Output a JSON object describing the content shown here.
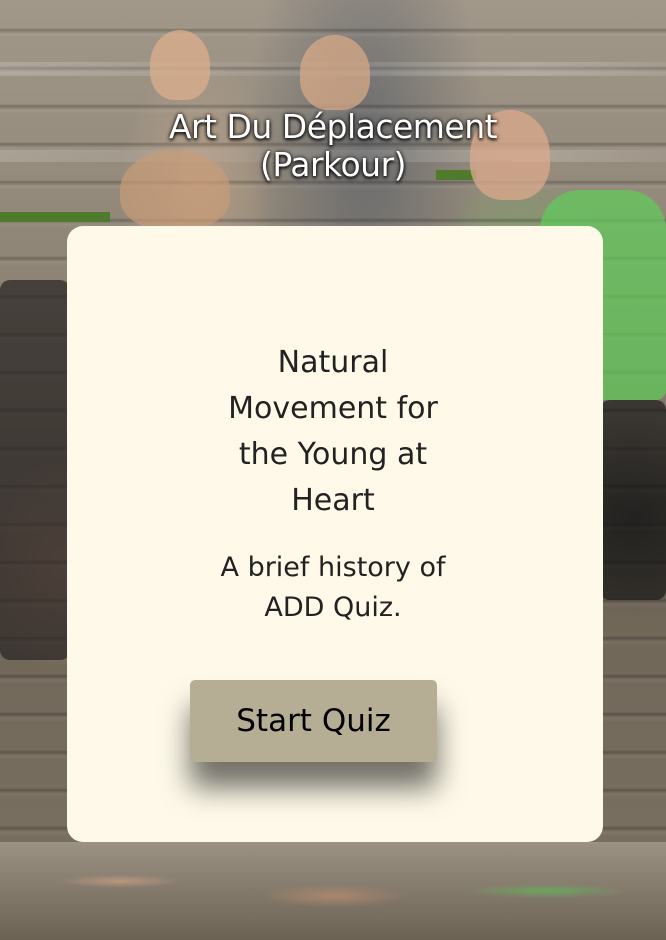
{
  "header": {
    "title_line1": "Art Du Déplacement",
    "title_line2": "(Parkour)"
  },
  "card": {
    "heading": "Natural Movement for the Young at Heart",
    "subtitle": "A brief history of ADD Quiz.",
    "start_button_label": "Start Quiz"
  },
  "background": {
    "image_subject": "group of young people running up outdoor steps",
    "card_color": "#fef9e8",
    "button_color": "#b6ae94"
  }
}
